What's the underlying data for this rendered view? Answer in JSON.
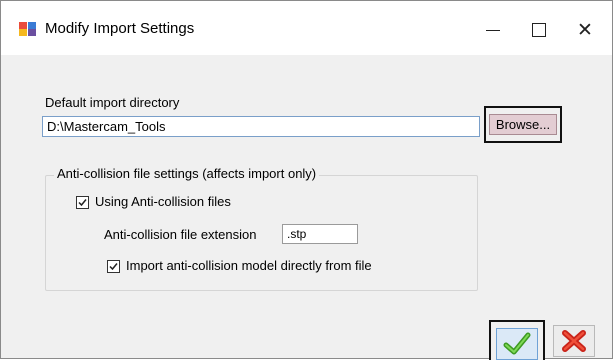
{
  "window": {
    "title": "Modify Import Settings",
    "minimize_glyph": "—",
    "maximize_glyph": "☐",
    "close_glyph": "✕"
  },
  "directory": {
    "label": "Default import directory",
    "value": "D:\\Mastercam_Tools",
    "browse_label": "Browse..."
  },
  "anticollision": {
    "group_title": "Anti-collision file settings (affects import only)",
    "use_files": {
      "label": "Using Anti-collision files",
      "checked": true
    },
    "extension_label": "Anti-collision file extension",
    "extension_value": ".stp",
    "import_directly": {
      "label": "Import anti-collision model directly from file",
      "checked": true
    }
  },
  "buttons": {
    "ok_icon": "green-checkmark-icon",
    "cancel_icon": "red-x-icon"
  },
  "colors": {
    "ok_check": "#4caf2a",
    "cancel_x": "#e0321c",
    "browse_bg": "#e3cdd3"
  }
}
